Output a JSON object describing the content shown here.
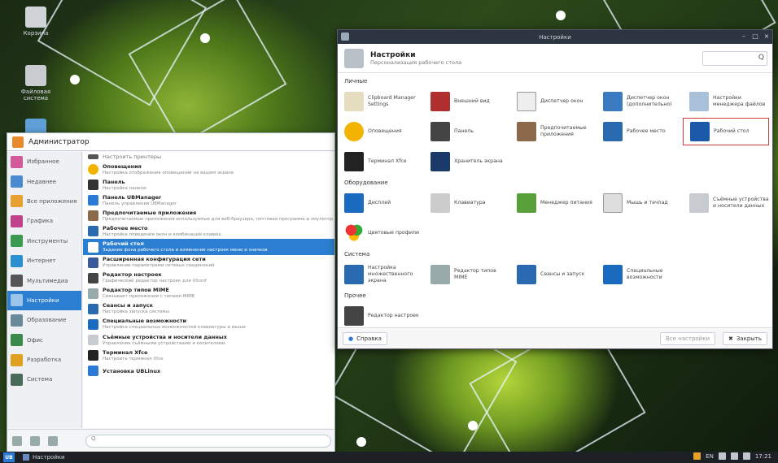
{
  "desktop": {
    "icons": [
      {
        "label": "Корзина"
      },
      {
        "label": "Файловая система"
      }
    ]
  },
  "start_menu": {
    "user": "Администратор",
    "categories": [
      {
        "label": "Избранное"
      },
      {
        "label": "Недавнее"
      },
      {
        "label": "Все приложения"
      },
      {
        "label": "Графика"
      },
      {
        "label": "Инструменты"
      },
      {
        "label": "Интернет"
      },
      {
        "label": "Мультимедиа"
      },
      {
        "label": "Настройки"
      },
      {
        "label": "Образование"
      },
      {
        "label": "Офис"
      },
      {
        "label": "Разработка"
      },
      {
        "label": "Система"
      }
    ],
    "apps": [
      {
        "name": "Настроить принтеры",
        "desc": ""
      },
      {
        "name": "Оповещения",
        "desc": "Настройка отображения оповещений на вашем экране"
      },
      {
        "name": "Панель",
        "desc": "Настройка панели"
      },
      {
        "name": "Панель UBManager",
        "desc": "Панель управления UBManager"
      },
      {
        "name": "Предпочитаемые приложения",
        "desc": "Предпочитаемые приложения используемые для веб-браузера, почтовая программа и эмулятор..."
      },
      {
        "name": "Рабочее место",
        "desc": "Настройка поведения окон и комбинаций клавиш"
      },
      {
        "name": "Рабочий стол",
        "desc": "Задание фона рабочего стола и изменение настроек меню и значков"
      },
      {
        "name": "Расширенная конфигурация сети",
        "desc": "Управление параметрами сетевых соединений"
      },
      {
        "name": "Редактор настроек",
        "desc": "Графический редактор настроек для Xfconf"
      },
      {
        "name": "Редактор типов MIME",
        "desc": "Связывает приложения с типами MIME"
      },
      {
        "name": "Сеансы и запуск",
        "desc": "Настройка запуска системы"
      },
      {
        "name": "Специальные возможности",
        "desc": "Настройка специальных возможностей клавиатуры и мыши"
      },
      {
        "name": "Съёмные устройства и носители данных",
        "desc": "Управление съёмными устройствами и носителями"
      },
      {
        "name": "Терминал Xfce",
        "desc": "Настроить терминал Xfce"
      },
      {
        "name": "Установка UBLinux",
        "desc": ""
      }
    ],
    "search_placeholder": "Q"
  },
  "window": {
    "title": "Настройки",
    "header_title": "Настройки",
    "header_subtitle": "Персонализация рабочего стола",
    "search_icon": "Q",
    "sections": [
      {
        "title": "Личные",
        "rows": [
          [
            {
              "label": "Clipboard Manager Settings"
            },
            {
              "label": "Внешний вид"
            },
            {
              "label": "Диспетчер окон"
            },
            {
              "label": "Диспетчер окон (дополнительно)"
            },
            {
              "label": "Настройки менеджера файлов"
            }
          ],
          [
            {
              "label": "Оповещения"
            },
            {
              "label": "Панель"
            },
            {
              "label": "Предпочитаемые приложения"
            },
            {
              "label": "Рабочее место"
            },
            {
              "label": "Рабочий стол"
            }
          ],
          [
            {
              "label": "Терминал Xfce"
            },
            {
              "label": "Хранитель экрана"
            }
          ]
        ]
      },
      {
        "title": "Оборудование",
        "rows": [
          [
            {
              "label": "Дисплей"
            },
            {
              "label": "Клавиатура"
            },
            {
              "label": "Менеджер питания"
            },
            {
              "label": "Мышь и тачпад"
            },
            {
              "label": "Съёмные устройства и носители данных"
            }
          ],
          [
            {
              "label": "Цветовые профили"
            }
          ]
        ]
      },
      {
        "title": "Система",
        "rows": [
          [
            {
              "label": "Настройка множественного экрана"
            },
            {
              "label": "Редактор типов MIME"
            },
            {
              "label": "Сеансы и запуск"
            },
            {
              "label": "Специальные возможности"
            }
          ]
        ]
      },
      {
        "title": "Прочее",
        "rows": [
          [
            {
              "label": "Редактор настроек"
            }
          ]
        ]
      }
    ],
    "help_button": "Справка",
    "all_settings_button": "Все настройки",
    "close_button": "Закрыть"
  },
  "taskbar": {
    "start": "UB",
    "task": "Настройки",
    "lang": "EN",
    "time": "17:21"
  },
  "colors": {
    "accent": "#2c7fd0",
    "highlight": "#d03a3a",
    "titlebar": "#2d3540"
  }
}
